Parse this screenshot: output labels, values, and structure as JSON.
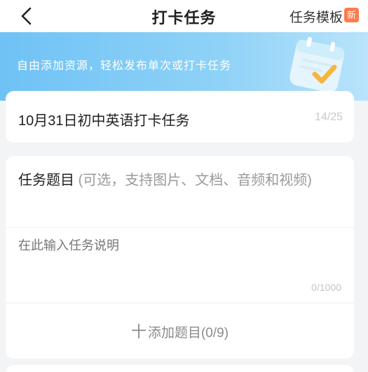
{
  "header": {
    "title": "打卡任务",
    "template_label": "任务模板",
    "badge": "新",
    "back_icon": "chevron-left-icon"
  },
  "banner": {
    "text": "自由添加资源，轻松发布单次或打卡任务",
    "illustration": "calendar-check-icon"
  },
  "task_name": {
    "value": "10月31日初中英语打卡任务",
    "count": "14/25"
  },
  "task_content": {
    "heading": "任务题目",
    "heading_hint": "(可选，支持图片、文档、音频和视频)",
    "description_placeholder": "在此输入任务说明",
    "description_count": "0/1000",
    "add_label": "添加题目(0/9)",
    "add_symbol": "十"
  },
  "colors": {
    "banner_start": "#6fc2f5",
    "banner_end": "#b9e3fb",
    "badge": "#ff7a4d"
  }
}
